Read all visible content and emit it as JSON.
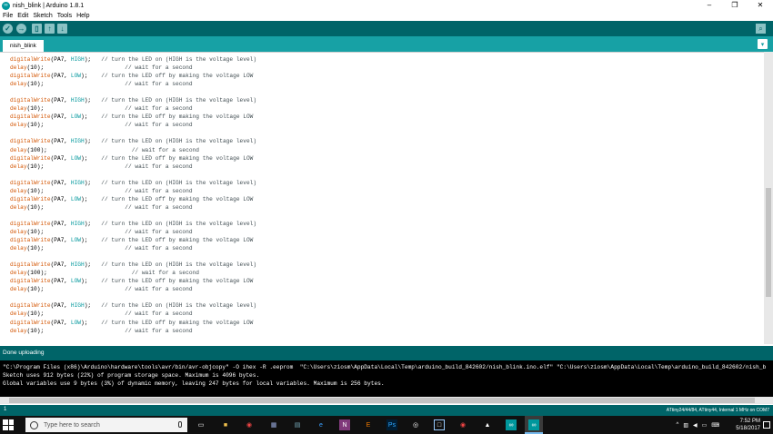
{
  "window": {
    "title": "nish_blink | Arduino 1.8.1",
    "controls": [
      "–",
      "❐",
      "✕"
    ]
  },
  "menu": [
    "File",
    "Edit",
    "Sketch",
    "Tools",
    "Help"
  ],
  "toolbar": {
    "verify_icon": "check-icon",
    "upload_icon": "arrow-right-icon",
    "new_icon": "new-file-icon",
    "open_icon": "arrow-up-icon",
    "save_icon": "arrow-down-icon",
    "serial_monitor_icon": "magnifier-icon"
  },
  "tabs": [
    {
      "label": "nish_blink"
    }
  ],
  "code_lines": [
    {
      "fn": "digitalWrite",
      "args": [
        "PA7",
        "HIGH"
      ],
      "comment": "// turn the LED on (HIGH is the voltage level)",
      "pad": "   "
    },
    {
      "fn": "delay",
      "args": [
        "10"
      ],
      "comment": "// wait for a second",
      "pad": "                        "
    },
    {
      "fn": "digitalWrite",
      "args": [
        "PA7",
        "LOW"
      ],
      "comment": "// turn the LED off by making the voltage LOW",
      "pad": "    "
    },
    {
      "fn": "delay",
      "args": [
        "10"
      ],
      "comment": "// wait for a second",
      "pad": "                        "
    },
    {
      "blank": true
    },
    {
      "fn": "digitalWrite",
      "args": [
        "PA7",
        "HIGH"
      ],
      "comment": "// turn the LED on (HIGH is the voltage level)",
      "pad": "   "
    },
    {
      "fn": "delay",
      "args": [
        "10"
      ],
      "comment": "// wait for a second",
      "pad": "                        "
    },
    {
      "fn": "digitalWrite",
      "args": [
        "PA7",
        "LOW"
      ],
      "comment": "// turn the LED off by making the voltage LOW",
      "pad": "    "
    },
    {
      "fn": "delay",
      "args": [
        "10"
      ],
      "comment": "// wait for a second",
      "pad": "                        "
    },
    {
      "blank": true
    },
    {
      "fn": "digitalWrite",
      "args": [
        "PA7",
        "HIGH"
      ],
      "comment": "// turn the LED on (HIGH is the voltage level)",
      "pad": "   "
    },
    {
      "fn": "delay",
      "args": [
        "100"
      ],
      "comment": "// wait for a second",
      "pad": "                         "
    },
    {
      "fn": "digitalWrite",
      "args": [
        "PA7",
        "LOW"
      ],
      "comment": "// turn the LED off by making the voltage LOW",
      "pad": "    "
    },
    {
      "fn": "delay",
      "args": [
        "10"
      ],
      "comment": "// wait for a second",
      "pad": "                        "
    },
    {
      "blank": true
    },
    {
      "fn": "digitalWrite",
      "args": [
        "PA7",
        "HIGH"
      ],
      "comment": "// turn the LED on (HIGH is the voltage level)",
      "pad": "   "
    },
    {
      "fn": "delay",
      "args": [
        "10"
      ],
      "comment": "// wait for a second",
      "pad": "                        "
    },
    {
      "fn": "digitalWrite",
      "args": [
        "PA7",
        "LOW"
      ],
      "comment": "// turn the LED off by making the voltage LOW",
      "pad": "    "
    },
    {
      "fn": "delay",
      "args": [
        "10"
      ],
      "comment": "// wait for a second",
      "pad": "                        "
    },
    {
      "blank": true
    },
    {
      "fn": "digitalWrite",
      "args": [
        "PA7",
        "HIGH"
      ],
      "comment": "// turn the LED on (HIGH is the voltage level)",
      "pad": "   "
    },
    {
      "fn": "delay",
      "args": [
        "10"
      ],
      "comment": "// wait for a second",
      "pad": "                        "
    },
    {
      "fn": "digitalWrite",
      "args": [
        "PA7",
        "LOW"
      ],
      "comment": "// turn the LED off by making the voltage LOW",
      "pad": "    "
    },
    {
      "fn": "delay",
      "args": [
        "10"
      ],
      "comment": "// wait for a second",
      "pad": "                        "
    },
    {
      "blank": true
    },
    {
      "fn": "digitalWrite",
      "args": [
        "PA7",
        "HIGH"
      ],
      "comment": "// turn the LED on (HIGH is the voltage level)",
      "pad": "   "
    },
    {
      "fn": "delay",
      "args": [
        "100"
      ],
      "comment": "// wait for a second",
      "pad": "                         "
    },
    {
      "fn": "digitalWrite",
      "args": [
        "PA7",
        "LOW"
      ],
      "comment": "// turn the LED off by making the voltage LOW",
      "pad": "    "
    },
    {
      "fn": "delay",
      "args": [
        "10"
      ],
      "comment": "// wait for a second",
      "pad": "                        "
    },
    {
      "blank": true
    },
    {
      "fn": "digitalWrite",
      "args": [
        "PA7",
        "HIGH"
      ],
      "comment": "// turn the LED on (HIGH is the voltage level)",
      "pad": "   "
    },
    {
      "fn": "delay",
      "args": [
        "10"
      ],
      "comment": "// wait for a second",
      "pad": "                        "
    },
    {
      "fn": "digitalWrite",
      "args": [
        "PA7",
        "LOW"
      ],
      "comment": "// turn the LED off by making the voltage LOW",
      "pad": "    "
    },
    {
      "fn": "delay",
      "args": [
        "10"
      ],
      "comment": "// wait for a second",
      "pad": "                        "
    },
    {
      "blank": true
    },
    {
      "blank": true
    },
    {
      "raw": "}"
    }
  ],
  "status": {
    "message": "Done uploading"
  },
  "console_lines": [
    "\"C:\\Program Files (x86)\\Arduino\\hardware\\tools\\avr/bin/avr-objcopy\" -O ihex -R .eeprom  \"C:\\Users\\ziosm\\AppData\\Local\\Temp\\arduino_build_842602/nish_blink.ino.elf\" \"C:\\Users\\ziosm\\AppData\\Local\\Temp\\arduino_build_842602/nish_b",
    "Sketch uses 912 bytes (22%) of program storage space. Maximum is 4096 bytes.",
    "Global variables use 9 bytes (3%) of dynamic memory, leaving 247 bytes for local variables. Maximum is 256 bytes."
  ],
  "footer": {
    "line_number": "1",
    "board": "ATtiny24/44/84, ATtiny44, Internal 1 MHz on COM7"
  },
  "taskbar": {
    "search_placeholder": "Type here to search",
    "time": "7:52 PM",
    "date": "5/18/2017",
    "apps": [
      "task-view-icon",
      "file-explorer-icon",
      "chrome-icon",
      "photos-icon",
      "edge-icon",
      "onenote-icon",
      "folder-icon",
      "photoshop-icon",
      "blender-icon",
      "explorer-icon",
      "chrome-icon",
      "image-icon",
      "arduino-icon",
      "arduino-icon"
    ]
  },
  "colors": {
    "toolbar": "#006468",
    "tabbar": "#17a1a5",
    "keyword": "#d35400",
    "constant": "#00979c",
    "comment": "#434f54"
  }
}
